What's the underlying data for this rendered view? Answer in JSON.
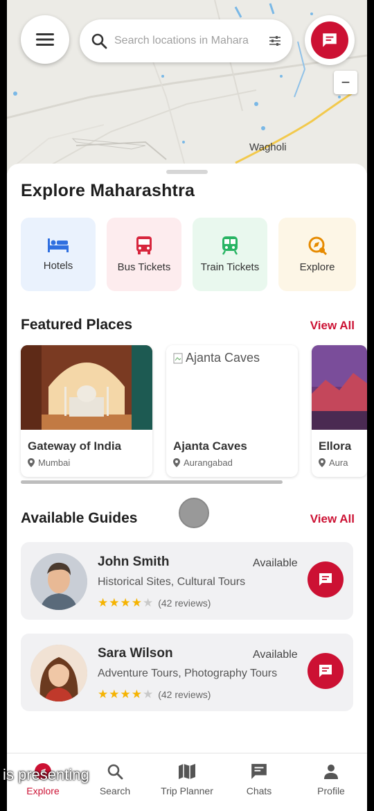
{
  "map": {
    "place_label": "Wagholi",
    "zoom_out_label": "−"
  },
  "search": {
    "placeholder": "Search locations in Mahara"
  },
  "sheet": {
    "title": "Explore Maharashtra"
  },
  "categories": [
    {
      "label": "Hotels",
      "icon": "bed-icon",
      "bg": "#eaf2fd",
      "color": "#2f6fe0"
    },
    {
      "label": "Bus Tickets",
      "icon": "bus-icon",
      "bg": "#fdecee",
      "color": "#d7263d"
    },
    {
      "label": "Train Tickets",
      "icon": "train-icon",
      "bg": "#e9f8ee",
      "color": "#28b463"
    },
    {
      "label": "Explore",
      "icon": "explore-icon",
      "bg": "#fdf6e6",
      "color": "#e68a00"
    }
  ],
  "featured": {
    "title": "Featured Places",
    "view_all": "View All",
    "places": [
      {
        "name": "Gateway of India",
        "location": "Mumbai"
      },
      {
        "name": "Ajanta Caves",
        "location": "Aurangabad",
        "image_alt": "Ajanta Caves"
      },
      {
        "name": "Ellora",
        "location": "Aura"
      }
    ]
  },
  "guides": {
    "title": "Available Guides",
    "view_all": "View All",
    "items": [
      {
        "name": "John Smith",
        "specialty": "Historical Sites, Cultural Tours",
        "status": "Available",
        "rating": 4,
        "reviews": "(42 reviews)"
      },
      {
        "name": "Sara Wilson",
        "specialty": "Adventure Tours, Photography Tours",
        "status": "Available",
        "rating": 4,
        "reviews": "(42 reviews)"
      }
    ]
  },
  "nav": [
    {
      "label": "Explore",
      "icon": "compass-icon",
      "active": true
    },
    {
      "label": "Search",
      "icon": "search-icon",
      "active": false
    },
    {
      "label": "Trip Planner",
      "icon": "map-icon",
      "active": false
    },
    {
      "label": "Chats",
      "icon": "chat-icon",
      "active": false
    },
    {
      "label": "Profile",
      "icon": "person-icon",
      "active": false
    }
  ],
  "caption": "is presenting",
  "colors": {
    "accent": "#cc1133"
  }
}
